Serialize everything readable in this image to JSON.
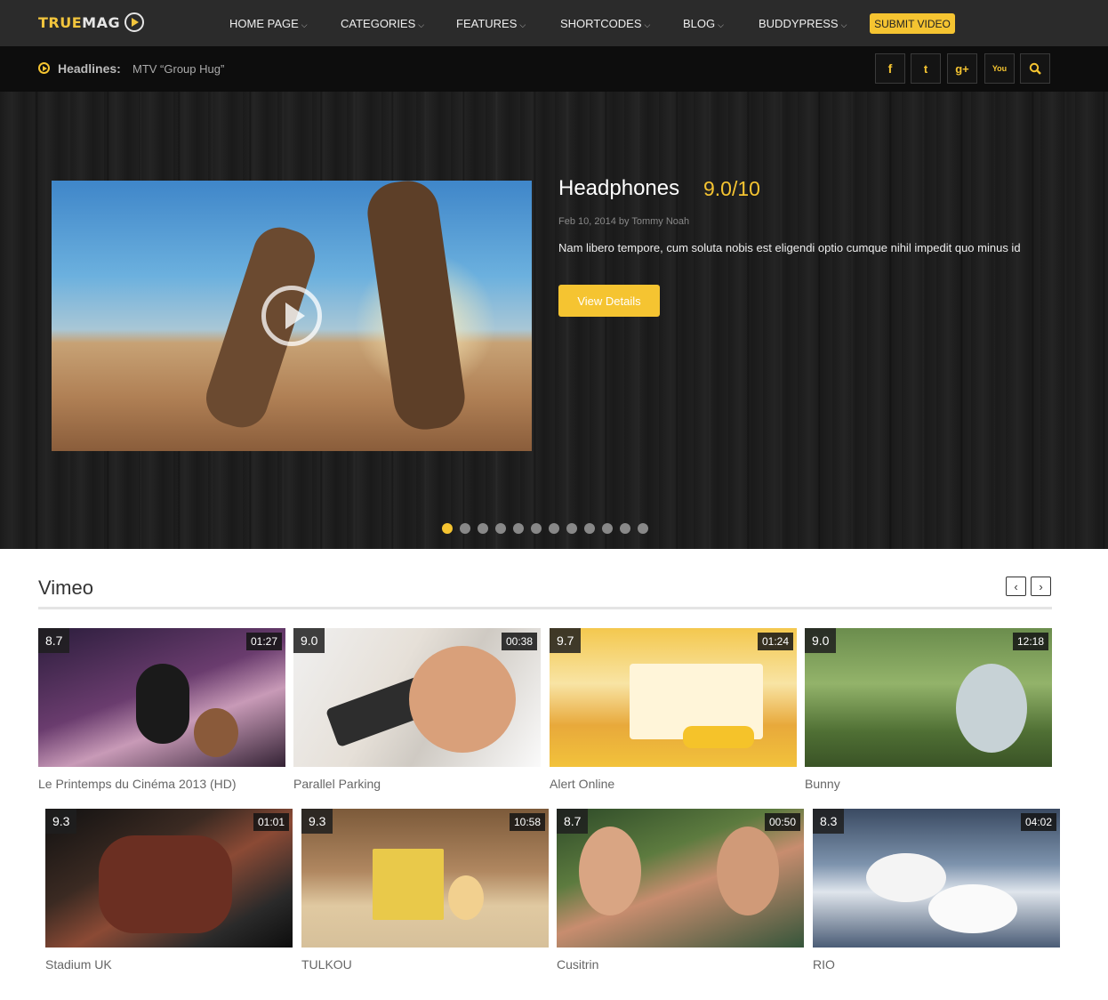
{
  "logo": {
    "part1": "TRUE",
    "part2": "MAG"
  },
  "nav": {
    "items": [
      {
        "label": "HOME PAGE"
      },
      {
        "label": "CATEGORIES"
      },
      {
        "label": "FEATURES"
      },
      {
        "label": "SHORTCODES"
      },
      {
        "label": "BLOG"
      },
      {
        "label": "BUDDYPRESS"
      }
    ],
    "submit_label": "SUBMIT VIDEO"
  },
  "headlines": {
    "label": "Headlines:",
    "text": "MTV “Group Hug”"
  },
  "social": {
    "facebook": "f",
    "twitter": "t",
    "gplus": "g+",
    "youtube": "You",
    "search": "⚲"
  },
  "hero": {
    "title": "Headphones",
    "score": "9.0/10",
    "meta": "Feb 10, 2014 by Tommy Noah",
    "description": "Nam libero tempore, cum soluta nobis est eligendi optio cumque nihil impedit quo minus id",
    "button": "View Details",
    "slide_count": 12,
    "active_slide": 1
  },
  "section": {
    "title": "Vimeo",
    "prev": "‹",
    "next": "›"
  },
  "videos": [
    {
      "score": "8.7",
      "duration": "01:27",
      "title": "Le Printemps du Cinéma 2013 (HD)"
    },
    {
      "score": "9.0",
      "duration": "00:38",
      "title": "Parallel Parking"
    },
    {
      "score": "9.7",
      "duration": "01:24",
      "title": "Alert Online"
    },
    {
      "score": "9.0",
      "duration": "12:18",
      "title": "Bunny"
    },
    {
      "score": "9.3",
      "duration": "01:01",
      "title": "Stadium UK"
    },
    {
      "score": "9.3",
      "duration": "10:58",
      "title": "TULKOU"
    },
    {
      "score": "8.7",
      "duration": "00:50",
      "title": "Cusitrin"
    },
    {
      "score": "8.3",
      "duration": "04:02",
      "title": "RIO"
    }
  ],
  "colors": {
    "accent": "#f5c431",
    "nav_bg": "#2b2b2b",
    "subbar_bg": "#0d0d0d"
  }
}
